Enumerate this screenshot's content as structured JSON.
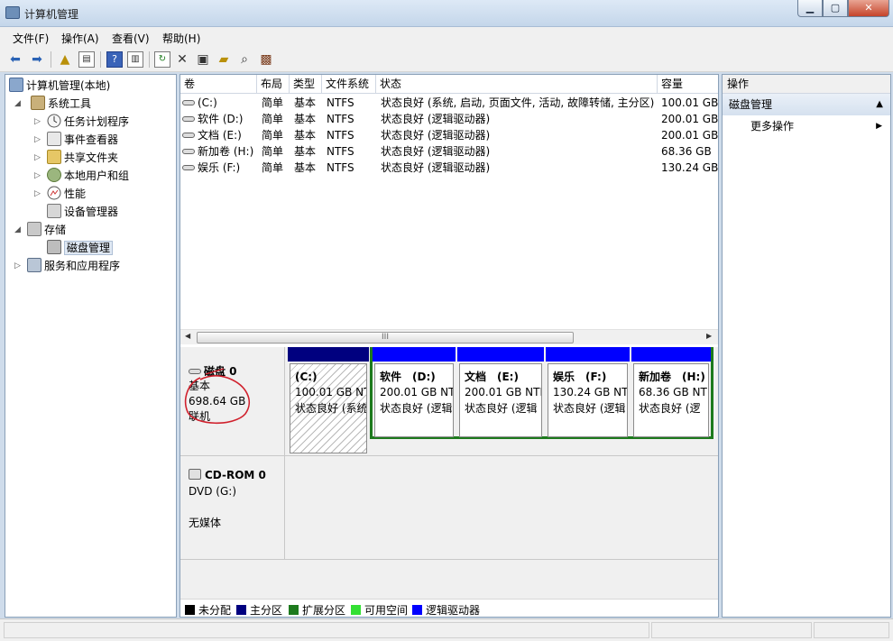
{
  "window": {
    "title": "计算机管理"
  },
  "menu": [
    "文件(F)",
    "操作(A)",
    "查看(V)",
    "帮助(H)"
  ],
  "tree": [
    {
      "label": "计算机管理(本地)",
      "indent": 0,
      "expander": "",
      "icon": "computer-icon"
    },
    {
      "label": "系统工具",
      "indent": 1,
      "expander": "◢",
      "icon": "tools-icon"
    },
    {
      "label": "任务计划程序",
      "indent": 2,
      "expander": "▷",
      "icon": "clock-icon"
    },
    {
      "label": "事件查看器",
      "indent": 2,
      "expander": "▷",
      "icon": "event-viewer-icon"
    },
    {
      "label": "共享文件夹",
      "indent": 2,
      "expander": "▷",
      "icon": "shared-folder-icon"
    },
    {
      "label": "本地用户和组",
      "indent": 2,
      "expander": "▷",
      "icon": "users-icon"
    },
    {
      "label": "性能",
      "indent": 2,
      "expander": "▷",
      "icon": "performance-icon"
    },
    {
      "label": "设备管理器",
      "indent": 2,
      "expander": "",
      "icon": "device-manager-icon"
    },
    {
      "label": "存储",
      "indent": 1,
      "expander": "◢",
      "icon": "storage-icon"
    },
    {
      "label": "磁盘管理",
      "indent": 2,
      "expander": "",
      "icon": "disk-management-icon",
      "selected": true
    },
    {
      "label": "服务和应用程序",
      "indent": 1,
      "expander": "▷",
      "icon": "services-icon"
    }
  ],
  "volume_table": {
    "columns": [
      "卷",
      "布局",
      "类型",
      "文件系统",
      "状态",
      "容量"
    ],
    "rows": [
      [
        "(C:)",
        "简单",
        "基本",
        "NTFS",
        "状态良好 (系统, 启动, 页面文件, 活动, 故障转储, 主分区)",
        "100.01 GB"
      ],
      [
        "软件 (D:)",
        "简单",
        "基本",
        "NTFS",
        "状态良好 (逻辑驱动器)",
        "200.01 GB"
      ],
      [
        "文档 (E:)",
        "简单",
        "基本",
        "NTFS",
        "状态良好 (逻辑驱动器)",
        "200.01 GB"
      ],
      [
        "新加卷 (H:)",
        "简单",
        "基本",
        "NTFS",
        "状态良好 (逻辑驱动器)",
        "68.36 GB"
      ],
      [
        "娱乐 (F:)",
        "简单",
        "基本",
        "NTFS",
        "状态良好 (逻辑驱动器)",
        "130.24 GB"
      ]
    ]
  },
  "scrollbar": {
    "grip": "III"
  },
  "disk0": {
    "name": "磁盘 0",
    "type": "基本",
    "size": "698.64 GB",
    "status": "联机",
    "partitions": [
      {
        "name": "(C:)",
        "size": "100.01 GB NT",
        "status": "状态良好 (系统",
        "kind": "primary"
      },
      {
        "name": "软件　(D:)",
        "size": "200.01 GB NT",
        "status": "状态良好 (逻辑",
        "kind": "logical"
      },
      {
        "name": "文档　(E:)",
        "size": "200.01 GB NTI",
        "status": "状态良好 (逻辑",
        "kind": "logical"
      },
      {
        "name": "娱乐　(F:)",
        "size": "130.24 GB NT",
        "status": "状态良好 (逻辑",
        "kind": "logical"
      },
      {
        "name": "新加卷　(H:)",
        "size": "68.36 GB NT",
        "status": "状态良好 (逻",
        "kind": "logical"
      }
    ]
  },
  "cdrom0": {
    "name": "CD-ROM 0",
    "drive": "DVD (G:)",
    "media": "无媒体"
  },
  "legend": [
    {
      "label": "未分配",
      "color": "#000000"
    },
    {
      "label": "主分区",
      "color": "#00007f"
    },
    {
      "label": "扩展分区",
      "color": "#1d7a1d"
    },
    {
      "label": "可用空间",
      "color": "#33e033"
    },
    {
      "label": "逻辑驱动器",
      "color": "#0000ff"
    }
  ],
  "actions": {
    "header": "操作",
    "section": "磁盘管理",
    "more": "更多操作"
  },
  "colors": {
    "primary_bar": "#00007f",
    "logical_bar": "#0000ff",
    "extended_border": "#1d7a1d",
    "annotation": "#d0202c"
  }
}
